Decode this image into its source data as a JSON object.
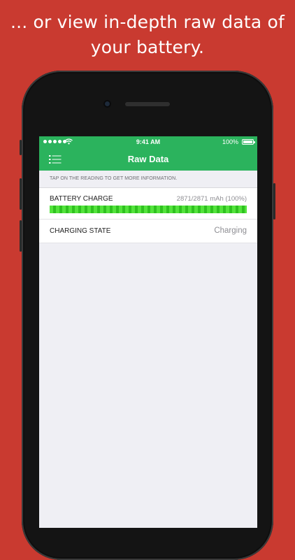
{
  "headline": {
    "line1": "... or view in-depth raw data of",
    "line2": "your battery."
  },
  "status_bar": {
    "time": "9:41 AM",
    "battery_percent": "100%",
    "signal_icon": "signal-dots-icon",
    "wifi_icon": "wifi-icon",
    "battery_icon": "battery-icon"
  },
  "nav": {
    "title": "Raw Data",
    "menu_icon": "list-menu-icon"
  },
  "hint": "TAP ON THE READING TO GET MORE INFORMATION.",
  "readings": {
    "battery_charge": {
      "label": "BATTERY CHARGE",
      "value": "2871/2871 mAh (100%)",
      "fill_fraction": 1.0
    },
    "charging_state": {
      "label": "CHARGING STATE",
      "value": "Charging"
    }
  },
  "colors": {
    "background": "#c93a30",
    "accent_green": "#2bb35d",
    "meter_green": "#53e33c"
  }
}
